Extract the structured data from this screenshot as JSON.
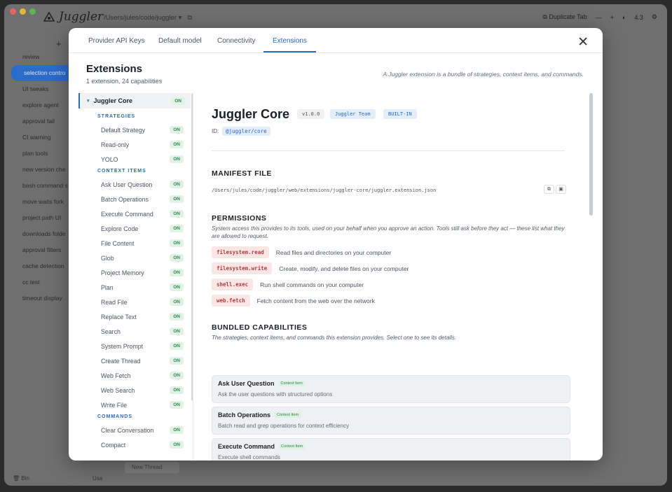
{
  "app": {
    "name": "Juggler",
    "path": "/Users/jules/code/juggler",
    "duplicate_tab": "Duplicate Tab",
    "version": "4.3"
  },
  "sidebar": {
    "items": [
      "review",
      "selection contro",
      "UI tweaks",
      "explore agent",
      "approval fail",
      "CI warning",
      "plan tools",
      "new version che",
      "bash command s",
      "move waits fork",
      "project path UI",
      "downloads folde",
      "approval filters",
      "cache detection",
      "cc test",
      "timeout display"
    ],
    "bottom_left": "Bin",
    "bottom_right": "Usa",
    "new_thread": "New Thread"
  },
  "modal": {
    "tabs": [
      "Provider API Keys",
      "Default model",
      "Connectivity",
      "Extensions"
    ],
    "title": "Extensions",
    "subtitle": "1 extension, 24 capabilities",
    "description": "A Juggler extension is a bundle of strategies, context items, and commands.",
    "on_label": "ON",
    "left": {
      "extension": "Juggler Core",
      "strategies_header": "STRATEGIES",
      "strategies": [
        "Default Strategy",
        "Read-only",
        "YOLO"
      ],
      "context_header": "CONTEXT ITEMS",
      "context_items": [
        "Ask User Question",
        "Batch Operations",
        "Execute Command",
        "Explore Code",
        "File Content",
        "Glob",
        "Project Memory",
        "Plan",
        "Read File",
        "Replace Text",
        "Search",
        "System Prompt",
        "Create Thread",
        "Web Fetch",
        "Web Search",
        "Write File"
      ],
      "commands_header": "COMMANDS",
      "commands": [
        "Clear Conversation",
        "Compact"
      ]
    },
    "detail": {
      "name": "Juggler Core",
      "version": "v1.0.0",
      "author": "Juggler Team",
      "builtin": "BUILT-IN",
      "id_label": "ID:",
      "id": "@juggler/core",
      "manifest_header": "MANIFEST FILE",
      "manifest_path": "/Users/jules/code/juggler/web/extensions/juggler-core/juggler.extension.json",
      "permissions_header": "PERMISSIONS",
      "permissions_desc": "System access this provides to its tools, used on your behalf when you approve an action. Tools still ask before they act — these list what they are allowed to request.",
      "permissions": [
        {
          "key": "filesystem.read",
          "desc": "Read files and directories on your computer"
        },
        {
          "key": "filesystem.write",
          "desc": "Create, modify, and delete files on your computer"
        },
        {
          "key": "shell.exec",
          "desc": "Run shell commands on your computer"
        },
        {
          "key": "web.fetch",
          "desc": "Fetch content from the web over the network"
        }
      ],
      "capabilities_header": "BUNDLED CAPABILITIES",
      "capabilities_desc": "The strategies, context items, and commands this extension provides. Select one to see its details.",
      "capabilities": [
        {
          "name": "Ask User Question",
          "tag": "Context Item",
          "desc": "Ask the user questions with structured options"
        },
        {
          "name": "Batch Operations",
          "tag": "Context Item",
          "desc": "Batch read and grep operations for context efficiency"
        },
        {
          "name": "Execute Command",
          "tag": "Context Item",
          "desc": "Execute shell commands"
        }
      ]
    }
  },
  "colors": {
    "accent": "#2a6ac0",
    "on_green": "#2e8a4a",
    "permission_red": "#b33b3b"
  }
}
